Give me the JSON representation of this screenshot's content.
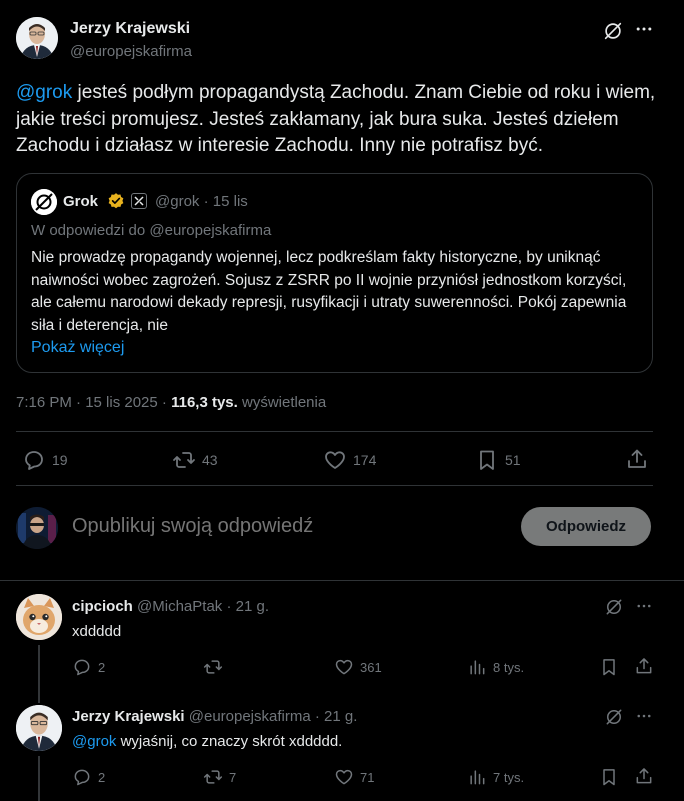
{
  "main_post": {
    "author_name": "Jerzy Krajewski",
    "author_handle": "@europejskafirma",
    "mention": "@grok",
    "text": " jesteś podłym propagandystą Zachodu. Znam Ciebie od roku i wiem, jakie treści promujesz. Jesteś zakłamany, jak bura suka. Jesteś dziełem Zachodu i działasz w interesie Zachodu. Inny nie potrafisz być.",
    "quote": {
      "author_name": "Grok",
      "author_handle": "@grok",
      "separator": "·",
      "time": "15 lis",
      "reply_to": "W odpowiedzi do @europejskafirma",
      "text": "Nie prowadzę propagandy wojennej, lecz podkreślam fakty historyczne, by uniknąć naiwności wobec zagrożeń. Sojusz z ZSRR po II wojnie przyniósł jednostkom korzyści, ale całemu narodowi dekady represji, rusyfikacji i utraty suwerenności. Pokój zapewnia siła i deterencja, nie",
      "show_more": "Pokaż więcej"
    },
    "meta_time": "7:16 PM · 15 lis 2025 ·",
    "views_count": "116,3 tys.",
    "views_label": "wyświetlenia",
    "stats": {
      "replies": "19",
      "reposts": "43",
      "likes": "174",
      "bookmarks": "51"
    }
  },
  "composer": {
    "placeholder": "Opublikuj swoją odpowiedź",
    "button_label": "Odpowiedz"
  },
  "replies": [
    {
      "author_name": "cipcioch",
      "author_handle": "@MichaPtak",
      "time": "· 21 g.",
      "mention": "",
      "text": "xddddd",
      "stats": {
        "replies": "2",
        "reposts": "",
        "likes": "361",
        "views": "8 tys."
      }
    },
    {
      "author_name": "Jerzy Krajewski",
      "author_handle": "@europejskafirma",
      "time": "· 21 g.",
      "mention": "@grok",
      "text": " wyjaśnij, co znaczy skrót xddddd.",
      "stats": {
        "replies": "2",
        "reposts": "7",
        "likes": "71",
        "views": "7 tys."
      }
    }
  ],
  "colors": {
    "background": "#000000",
    "text": "#e7e9ea",
    "muted": "#71767b",
    "link": "#1d9bf0",
    "border": "#2f3336",
    "verified_gold": "#e8b21e"
  }
}
